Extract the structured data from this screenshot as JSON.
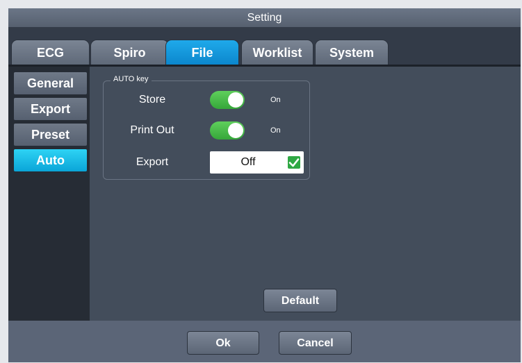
{
  "window": {
    "title": "Setting"
  },
  "tabs": [
    {
      "label": "ECG",
      "active": false
    },
    {
      "label": "Spiro",
      "active": false
    },
    {
      "label": "File",
      "active": true
    },
    {
      "label": "Worklist",
      "active": false
    },
    {
      "label": "System",
      "active": false
    }
  ],
  "sidebar": {
    "items": [
      {
        "label": "General",
        "active": false
      },
      {
        "label": "Export",
        "active": false
      },
      {
        "label": "Preset",
        "active": false
      },
      {
        "label": "Auto",
        "active": true
      }
    ]
  },
  "auto_key": {
    "group_title": "AUTO key",
    "store": {
      "label": "Store",
      "state": "On"
    },
    "print_out": {
      "label": "Print Out",
      "state": "On"
    },
    "export": {
      "label": "Export",
      "value": "Off",
      "checked": true
    }
  },
  "buttons": {
    "default": "Default",
    "ok": "Ok",
    "cancel": "Cancel"
  },
  "colors": {
    "active_tab": "#1fa9ea",
    "active_side": "#0aa5d8",
    "toggle_on": "#36a73a",
    "check": "#2fa844"
  }
}
